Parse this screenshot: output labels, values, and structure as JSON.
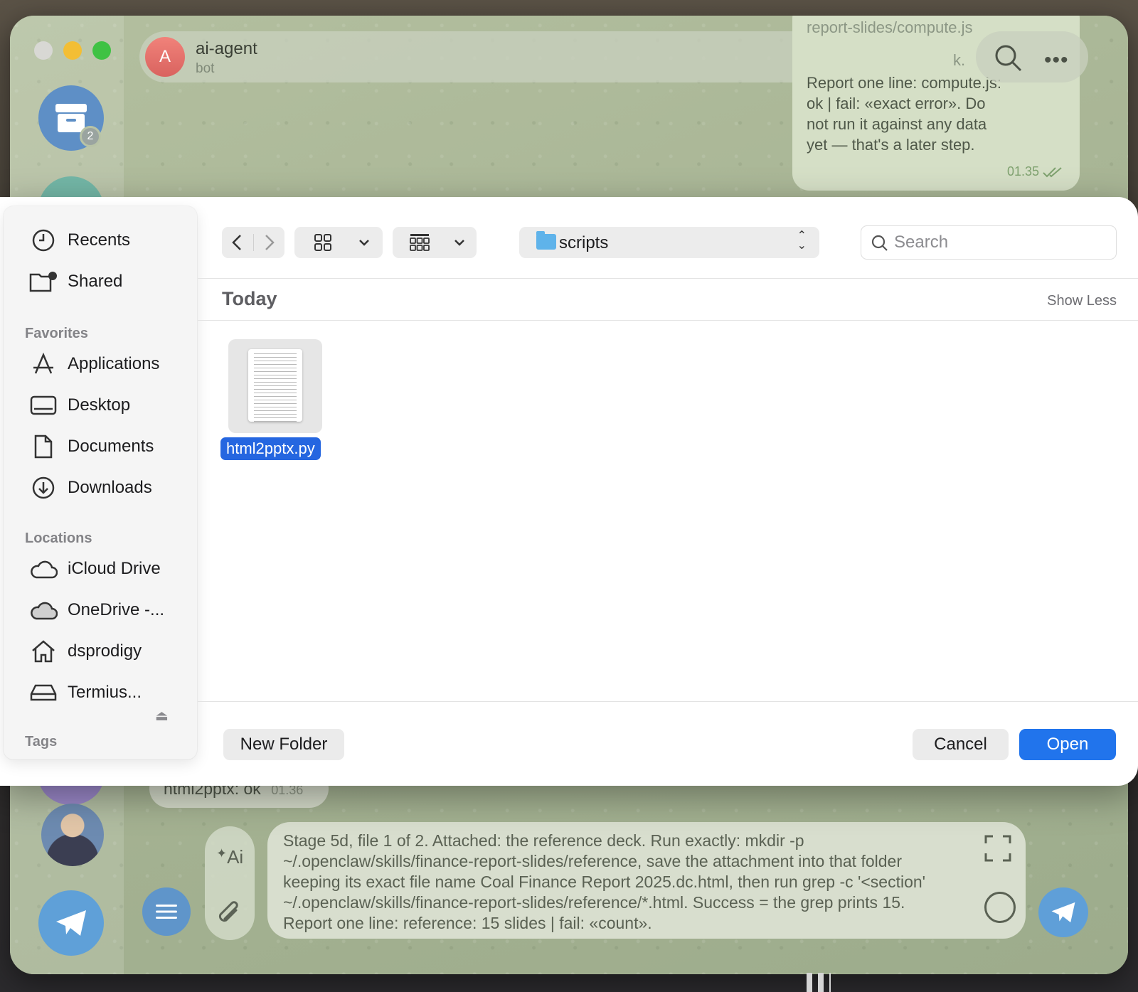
{
  "telegram": {
    "chat": {
      "avatar_letter": "A",
      "name": "ai-agent",
      "subtitle": "bot"
    },
    "archive_badge": "2",
    "outgoing_message": {
      "ghost_text": "report-slides/compute.js",
      "ghost_tail": "k.",
      "text": "Report one line: compute.js: ok | fail: «exact error». Do not run it against any data yet — that's a later step.",
      "time": "01.35"
    },
    "incoming_message": {
      "text": "html2pptx: ok",
      "time": "01.36"
    },
    "composer": {
      "text": "Stage 5d, file 1 of 2. Attached: the reference deck. Run exactly: mkdir -p ~/.openclaw/skills/finance-report-slides/reference, save the attachment into that folder keeping its exact file name Coal Finance Report 2025.dc.html, then run grep -c '<section' ~/.openclaw/skills/finance-report-slides/reference/*.html. Success = the grep prints 15. Report one line: reference: 15 slides | fail: «count»."
    },
    "ai_label": "Ai"
  },
  "dialog": {
    "sidebar": {
      "items_top": [
        {
          "label": "Recents",
          "icon": "clock-icon"
        },
        {
          "label": "Shared",
          "icon": "shared-folder-icon"
        }
      ],
      "favorites_heading": "Favorites",
      "favorites": [
        {
          "label": "Applications",
          "icon": "applications-icon"
        },
        {
          "label": "Desktop",
          "icon": "desktop-icon"
        },
        {
          "label": "Documents",
          "icon": "document-icon"
        },
        {
          "label": "Downloads",
          "icon": "download-icon"
        }
      ],
      "locations_heading": "Locations",
      "locations": [
        {
          "label": "iCloud Drive",
          "icon": "cloud-icon"
        },
        {
          "label": "OneDrive -...",
          "icon": "cloud-filled-icon"
        },
        {
          "label": "dsprodigy",
          "icon": "home-icon"
        },
        {
          "label": "Termius...",
          "icon": "drive-icon"
        }
      ],
      "tags_heading": "Tags"
    },
    "toolbar": {
      "current_folder": "scripts",
      "search_placeholder": "Search"
    },
    "section": {
      "title": "Today",
      "toggle": "Show Less"
    },
    "files": [
      {
        "name": "html2pptx.py",
        "selected": true
      }
    ],
    "buttons": {
      "new_folder": "New Folder",
      "cancel": "Cancel",
      "open": "Open"
    },
    "colors": {
      "accent": "#2174ec",
      "selection": "#2566e0",
      "folder": "#5fb3ea"
    }
  }
}
